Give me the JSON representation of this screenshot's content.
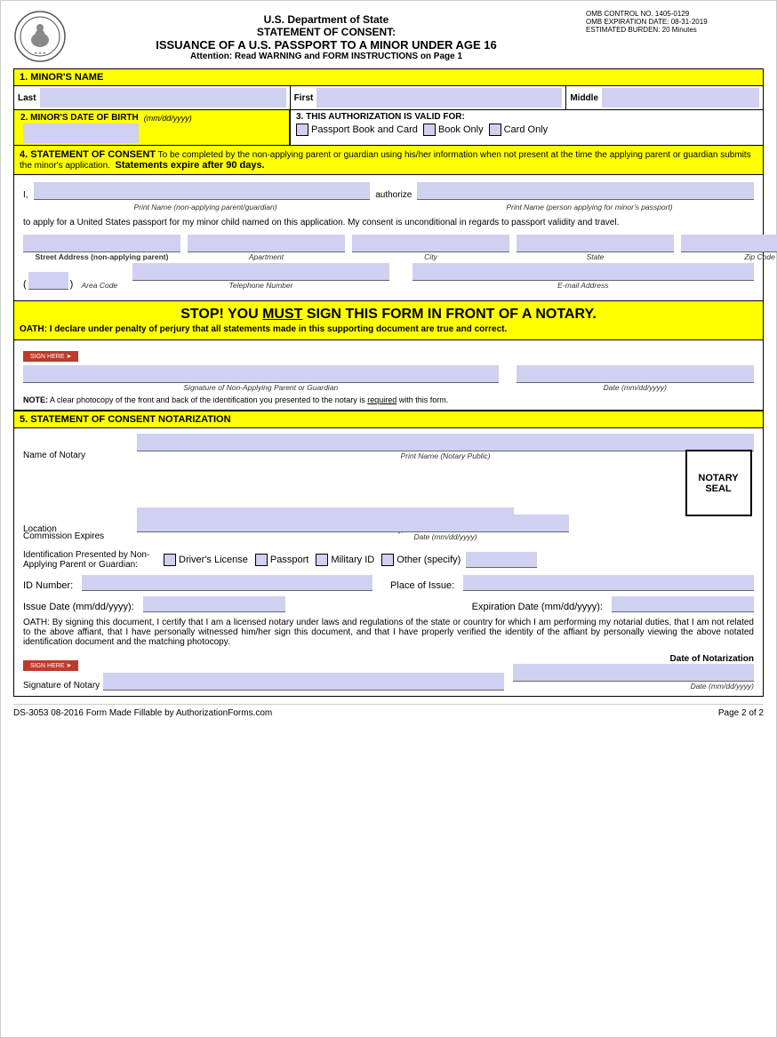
{
  "header": {
    "dept": "U.S. Department of State",
    "title1": "STATEMENT OF CONSENT:",
    "title2": "ISSUANCE OF A U.S. PASSPORT TO A MINOR UNDER AGE 16",
    "attention": "Attention: Read WARNING and FORM INSTRUCTIONS on Page 1",
    "omb1": "OMB CONTROL NO. 1405-0129",
    "omb2": "OMB EXPIRATION DATE: 08-31-2019",
    "omb3": "ESTIMATED BURDEN: 20 Minutes"
  },
  "section1": {
    "title": "1. MINOR'S NAME",
    "last_label": "Last",
    "first_label": "First",
    "middle_label": "Middle"
  },
  "section2": {
    "title": "2. MINOR'S DATE OF BIRTH",
    "date_format": "(mm/dd/yyyy)"
  },
  "section3": {
    "title": "3. THIS AUTHORIZATION IS VALID FOR:",
    "option1": "Passport Book and Card",
    "option2": "Book Only",
    "option3": "Card Only"
  },
  "section4": {
    "title": "4. STATEMENT OF CONSENT",
    "description": "To be completed by the non-applying parent or guardian using his/her information when not present at the time the applying parent or guardian submits the minor's application.",
    "expire_note": "Statements expire after 90 days.",
    "i_label": "I,",
    "authorize_label": "authorize",
    "print_name1_label": "Print Name (non-applying parent/guardian)",
    "print_name2_label": "Print Name (person applying for minor's passport)",
    "apply_text": "to apply for a United States passport for my minor child named on this application. My consent is unconditional in regards to passport validity and travel.",
    "street_label": "Street Address (non-applying parent)",
    "apt_label": "Apartment",
    "city_label": "City",
    "state_label": "State",
    "zip_label": "Zip Code",
    "area_code_label": "Area Code",
    "phone_label": "Telephone Number",
    "email_label": "E-mail Address",
    "stop_text": "STOP! YOU ",
    "must_text": "MUST",
    "sign_text": " SIGN THIS FORM IN FRONT OF A NOTARY.",
    "oath_text": "OATH:  I declare under penalty of perjury that all statements made in this supporting document are true and correct.",
    "sig_label": "Signature of Non-Applying Parent or Guardian",
    "date_label": "Date (mm/dd/yyyy)",
    "note_text": "NOTE: A clear photocopy of the front and back of the identification you presented to the notary is required with this form."
  },
  "section5": {
    "title": "5. STATEMENT OF CONSENT NOTARIZATION",
    "notary_name_label": "Name of Notary",
    "print_notary_label": "Print Name (Notary Public)",
    "location_label": "Location",
    "city_state_label": "City,  State",
    "commission_label": "Commission Expires",
    "date_format_label": "Date (mm/dd/yyyy)",
    "seal_label": "NOTARY\nSEAL",
    "id_presented_label": "Identification Presented by Non-Applying Parent or Guardian:",
    "drivers_license": "Driver's License",
    "passport": "Passport",
    "military_id": "Military ID",
    "other_specify": "Other (specify)",
    "id_number_label": "ID Number:",
    "place_of_issue_label": "Place of Issue:",
    "issue_date_label": "Issue Date (mm/dd/yyyy):",
    "expiration_date_label": "Expiration Date (mm/dd/yyyy):",
    "oath_text": "OATH: By signing this document, I certify that I am a licensed notary under laws and regulations of the state or country for which I am performing my notarial duties, that I am not related to the above affiant, that I have personally witnessed him/her sign this document, and that I have properly verified the identity of the affiant by personally viewing the above notated identification document and the matching photocopy.",
    "sig_notary_label": "Signature of Notary",
    "date_notarization_label": "Date of Notarization",
    "date_format": "Date (mm/dd/yyyy)"
  },
  "footer": {
    "left": "DS-3053   08-2016   Form Made Fillable by AuthorizationForms.com",
    "right": "Page 2 of 2"
  }
}
